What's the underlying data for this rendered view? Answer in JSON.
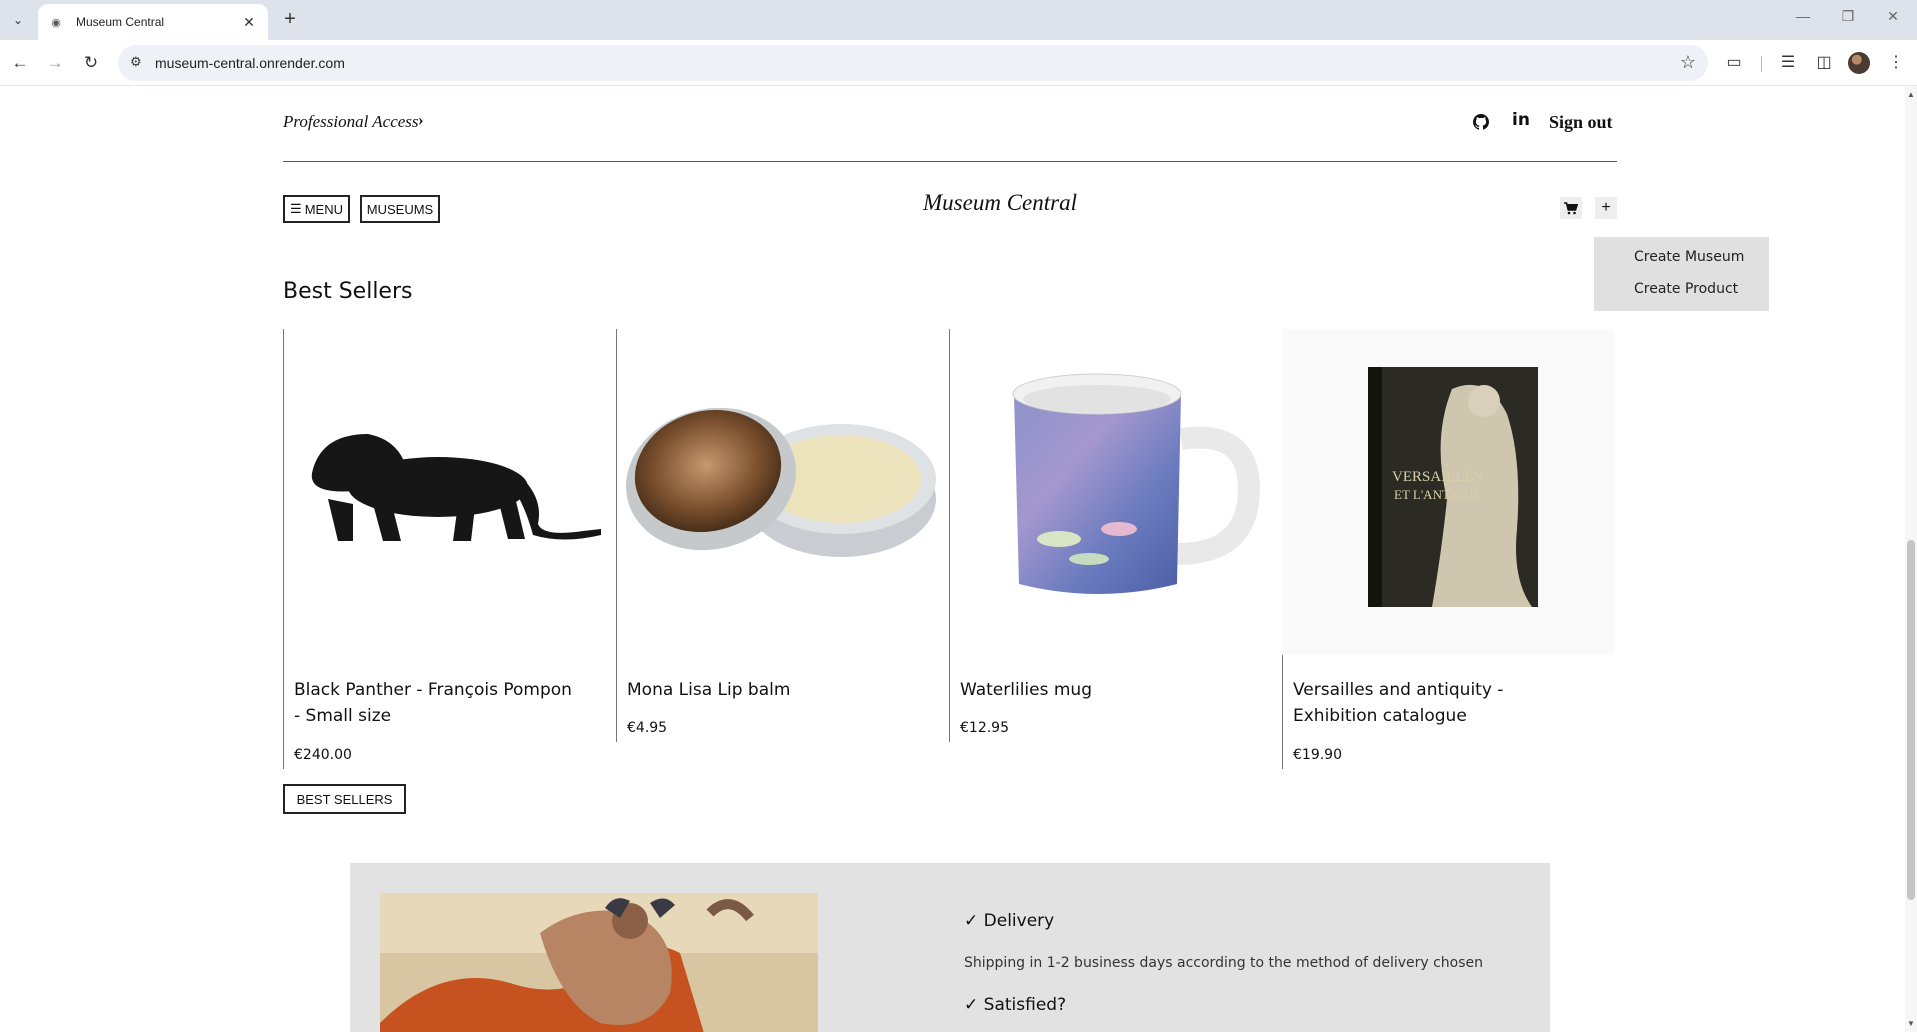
{
  "browser": {
    "tab_title": "Museum Central",
    "url": "museum-central.onrender.com"
  },
  "header": {
    "professional_access": "Professional Access",
    "sign_out": "Sign out"
  },
  "nav": {
    "menu_label": "MENU",
    "museums_label": "MUSEUMS",
    "brand": "Museum Central"
  },
  "create_menu": {
    "items": [
      "Create Museum",
      "Create Product"
    ]
  },
  "best_sellers": {
    "title": "Best Sellers",
    "button_label": "BEST SELLERS",
    "products": [
      {
        "name": "Black Panther - François Pompon - Small size",
        "price": "€240.00"
      },
      {
        "name": "Mona Lisa Lip balm",
        "price": "€4.95"
      },
      {
        "name": "Waterlilies mug",
        "price": "€12.95"
      },
      {
        "name": "Versailles and antiquity - Exhibition catalogue",
        "price": "€19.90"
      }
    ]
  },
  "features": [
    {
      "title": "Delivery",
      "text": "Shipping in 1-2 business days according to the method of delivery chosen"
    },
    {
      "title": "Satisfied?",
      "text": ""
    }
  ],
  "book_cover_text": [
    "VERSAILLES",
    "ET L'ANTIQUE"
  ]
}
